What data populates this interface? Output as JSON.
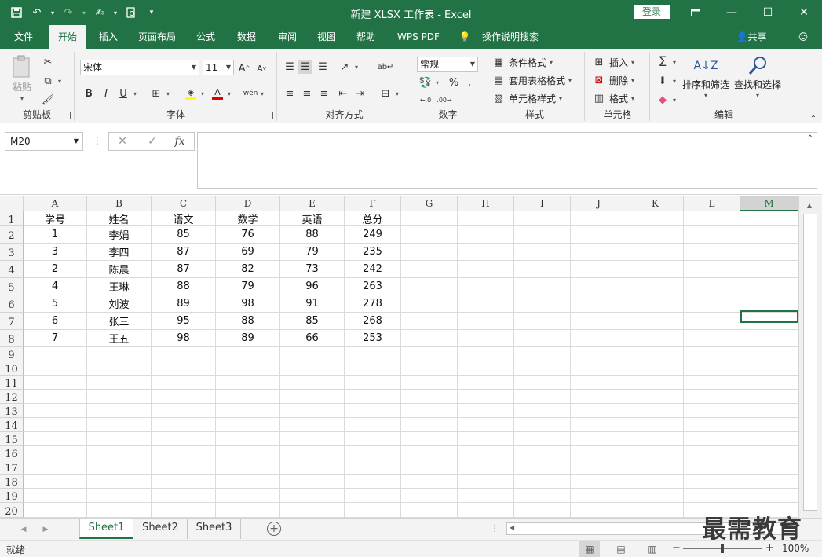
{
  "window": {
    "title": "新建 XLSX 工作表 - Excel",
    "login_label": "登录"
  },
  "ribbon_tabs": [
    "文件",
    "开始",
    "插入",
    "页面布局",
    "公式",
    "数据",
    "审阅",
    "视图",
    "帮助",
    "WPS PDF",
    "操作说明搜索"
  ],
  "share_label": "共享",
  "ribbon": {
    "clipboard": {
      "label": "剪贴板",
      "paste": "粘贴"
    },
    "font": {
      "label": "字体",
      "font_name": "宋体",
      "font_size": "11",
      "font_color": "#e00000",
      "highlight_color": "#ffff00"
    },
    "alignment": {
      "label": "对齐方式"
    },
    "number": {
      "label": "数字",
      "format": "常规"
    },
    "styles": {
      "label": "样式",
      "conditional": "条件格式",
      "table": "套用表格格式",
      "cell_style": "单元格样式"
    },
    "cells": {
      "label": "单元格",
      "insert": "插入",
      "delete": "删除",
      "format": "格式"
    },
    "editing": {
      "label": "编辑",
      "sort": "排序和筛选",
      "find": "查找和选择"
    }
  },
  "name_box": "M20",
  "columns": [
    "A",
    "B",
    "C",
    "D",
    "E",
    "F",
    "G",
    "H",
    "I",
    "J",
    "K",
    "L",
    "M"
  ],
  "selected_column": "M",
  "rows": [
    "1",
    "2",
    "3",
    "4",
    "5",
    "6",
    "7",
    "8",
    "9",
    "10",
    "11",
    "12",
    "13",
    "14",
    "15",
    "16",
    "17",
    "18",
    "19",
    "20"
  ],
  "table": {
    "headers": [
      "学号",
      "姓名",
      "语文",
      "数学",
      "英语",
      "总分"
    ],
    "rows": [
      [
        "1",
        "李娟",
        "85",
        "76",
        "88",
        "249"
      ],
      [
        "3",
        "李四",
        "87",
        "69",
        "79",
        "235"
      ],
      [
        "2",
        "陈晨",
        "87",
        "82",
        "73",
        "242"
      ],
      [
        "4",
        "王琳",
        "88",
        "79",
        "96",
        "263"
      ],
      [
        "5",
        "刘波",
        "89",
        "98",
        "91",
        "278"
      ],
      [
        "6",
        "张三",
        "95",
        "88",
        "85",
        "268"
      ],
      [
        "7",
        "王五",
        "98",
        "89",
        "66",
        "253"
      ]
    ]
  },
  "sheets": [
    "Sheet1",
    "Sheet2",
    "Sheet3"
  ],
  "active_sheet": "Sheet1",
  "status": "就绪",
  "zoom": "100%",
  "zoom_fraction": 0.5,
  "watermark": "最需教育",
  "accent_color": "#217346"
}
